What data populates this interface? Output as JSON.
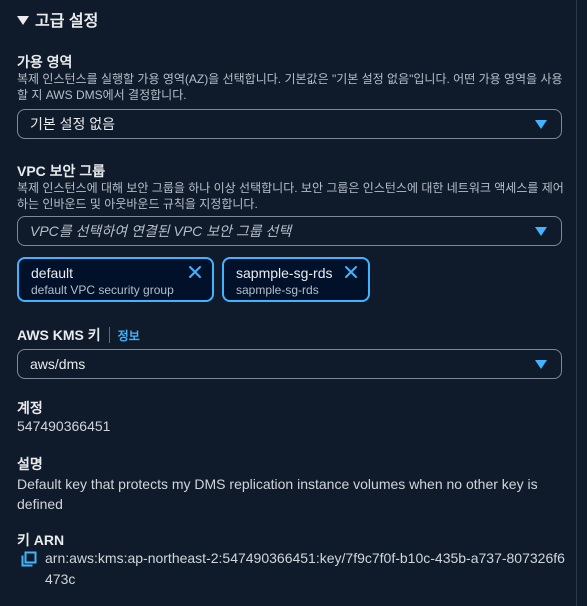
{
  "section": {
    "title": "고급 설정"
  },
  "availability_zone": {
    "label": "가용 영역",
    "description": "복제 인스턴스를 실행할 가용 영역(AZ)을 선택합니다. 기본값은 \"기본 설정 없음\"입니다. 어떤 가용 영역을 사용할 지 AWS DMS에서 결정합니다.",
    "selected": "기본 설정 없음"
  },
  "vpc_sg": {
    "label": "VPC 보안 그룹",
    "description": "복제 인스턴스에 대해 보안 그룹을 하나 이상 선택합니다. 보안 그룹은 인스턴스에 대한 네트워크 액세스를 제어하는 인바운드 및 아웃바운드 규칙을 지정합니다.",
    "placeholder": "VPC를 선택하여 연결된 VPC 보안 그룹 선택",
    "tokens": [
      {
        "name": "default",
        "desc": "default VPC security group"
      },
      {
        "name": "sapmple-sg-rds",
        "desc": "sapmple-sg-rds"
      }
    ]
  },
  "kms": {
    "label": "AWS KMS 키",
    "info": "정보",
    "selected": "aws/dms"
  },
  "account": {
    "label": "계정",
    "value": "547490366451"
  },
  "description_field": {
    "label": "설명",
    "value": "Default key that protects my DMS replication instance volumes when no other key is defined"
  },
  "key_arn": {
    "label": "키 ARN",
    "value": "arn:aws:kms:ap-northeast-2:547490366451:key/7f9c7f0f-b10c-435b-a737-807326f6473c"
  },
  "colors": {
    "background": "#0f1b2a",
    "accent": "#42b4ff",
    "text": "#e9ebed",
    "muted": "#b6bec9"
  },
  "icons": {
    "section_toggle": "caret-down-icon",
    "dropdown": "caret-down-icon",
    "remove": "close-icon",
    "copy": "copy-icon"
  }
}
